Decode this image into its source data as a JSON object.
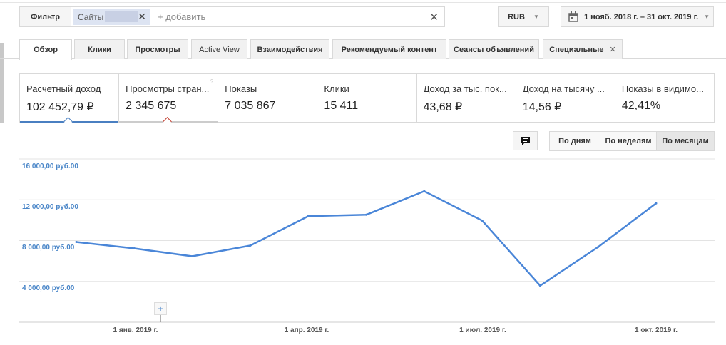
{
  "filter": {
    "label": "Фильтр",
    "chip": "Сайты",
    "add": "+ добавить"
  },
  "currency": "RUB",
  "date_range": "1 нояб. 2018 г. – 31 окт. 2019 г.",
  "tabs": [
    "Обзор",
    "Клики",
    "Просмотры",
    "Active View",
    "Взаимодействия",
    "Рекомендуемый контент",
    "Сеансы объявлений",
    "Специальные"
  ],
  "metrics": [
    {
      "label": "Расчетный доход",
      "value": "102 452,79 ₽"
    },
    {
      "label": "Просмотры стран...",
      "value": "2 345 675"
    },
    {
      "label": "Показы",
      "value": "7 035 867"
    },
    {
      "label": "Клики",
      "value": "15 411"
    },
    {
      "label": "Доход за тыс. пок...",
      "value": "43,68 ₽"
    },
    {
      "label": "Доход на тысячу ...",
      "value": "14,56 ₽"
    },
    {
      "label": "Показы в видимо...",
      "value": "42,41%"
    }
  ],
  "granularity": {
    "options": [
      "По дням",
      "По неделям",
      "По месяцам"
    ],
    "selected": "По месяцам"
  },
  "colors": {
    "series": "#4a86d8",
    "selected_metric": "#4a7fc1",
    "compare_metric": "#c0392b"
  },
  "chart_data": {
    "type": "line",
    "x": [
      "2018-12",
      "2019-01",
      "2019-02",
      "2019-03",
      "2019-04",
      "2019-05",
      "2019-06",
      "2019-07",
      "2019-08",
      "2019-09",
      "2019-10"
    ],
    "y": [
      7860,
      7230,
      6460,
      7510,
      10390,
      10530,
      12840,
      9960,
      3580,
      7370,
      11650
    ],
    "ylim": [
      0,
      16000
    ],
    "yticks": [
      "16 000,00 руб.00",
      "12 000,00 руб.00",
      "8 000,00 руб.00",
      "4 000,00 руб.00"
    ],
    "ytick_values": [
      16000,
      12000,
      8000,
      4000
    ],
    "xticks": [
      "1 янв. 2019 г.",
      "1 апр. 2019 г.",
      "1 июл. 2019 г.",
      "1 окт. 2019 г."
    ],
    "grid": true
  }
}
